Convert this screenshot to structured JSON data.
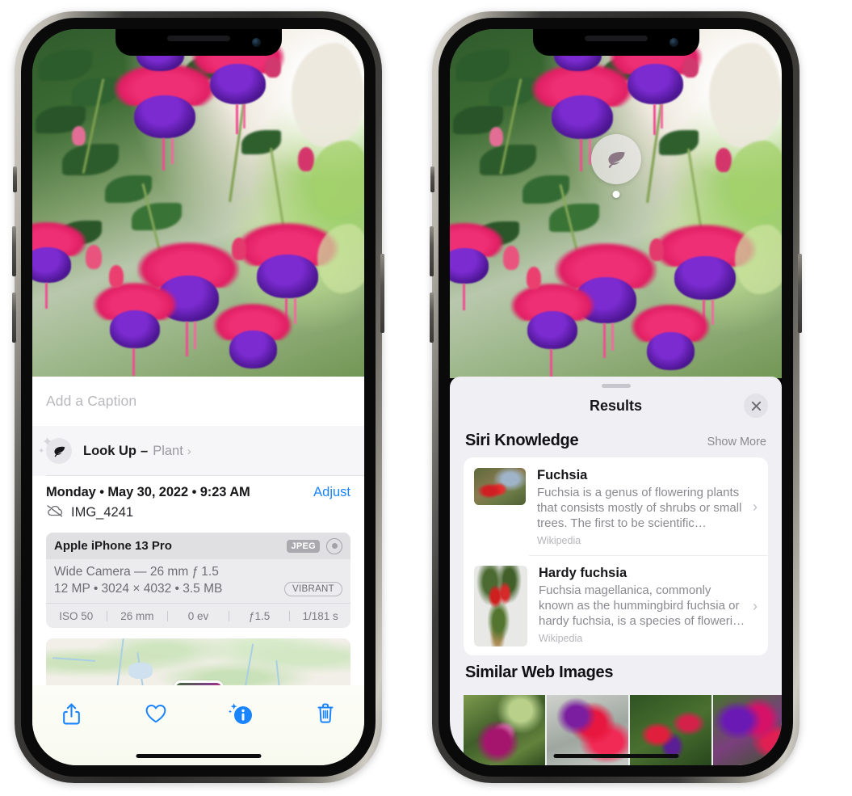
{
  "left_phone": {
    "name": "iphone-photos-info",
    "caption": {
      "placeholder": "Add a Caption",
      "value": ""
    },
    "look_up": {
      "icon": "leaf-icon",
      "title": "Look Up",
      "dash": "–",
      "subject": "Plant",
      "chevron": "›"
    },
    "metadata": {
      "date_line": "Monday • May 30, 2022 • 9:23 AM",
      "adjust_label": "Adjust",
      "cloud_icon": "icloud-slash-icon",
      "filename": "IMG_4241"
    },
    "camera_card": {
      "model": "Apple iPhone 13 Pro",
      "format_badge": "JPEG",
      "raw_icon": "raw-target-icon",
      "lens_line": "Wide Camera — 26 mm ƒ 1.5",
      "size_line": "12 MP • 3024 × 4032 • 3.5 MB",
      "profile_badge": "VIBRANT",
      "exif": [
        "ISO 50",
        "26 mm",
        "0 ev",
        "ƒ1.5",
        "1/181 s"
      ]
    },
    "map": {
      "pin": "photo-pin"
    },
    "toolbar": [
      {
        "name": "share-button",
        "icon": "share-icon"
      },
      {
        "name": "favorite-button",
        "icon": "heart-icon"
      },
      {
        "name": "info-button",
        "icon": "info-sparkle-icon"
      },
      {
        "name": "delete-button",
        "icon": "trash-icon"
      }
    ],
    "accent_color": "#1A84FF"
  },
  "right_phone": {
    "name": "iphone-visual-lookup-results",
    "visual_lookup_badge": {
      "icon": "leaf-icon"
    },
    "sheet": {
      "title": "Results",
      "close_icon": "close-icon",
      "sections": [
        {
          "title": "Siri Knowledge",
          "action": "Show More",
          "items": [
            {
              "title": "Fuchsia",
              "description": "Fuchsia is a genus of flowering plants that consists mostly of shrubs or small trees. The first to be scientific…",
              "source": "Wikipedia",
              "chevron": "›"
            },
            {
              "title": "Hardy fuchsia",
              "description": "Fuchsia magellanica, commonly known as the hummingbird fuchsia or hardy fuchsia, is a species of floweri…",
              "source": "Wikipedia",
              "chevron": "›"
            }
          ]
        },
        {
          "title": "Similar Web Images",
          "items": [
            {
              "alt": "fuchsia-web-image-1"
            },
            {
              "alt": "fuchsia-web-image-2"
            },
            {
              "alt": "fuchsia-web-image-3"
            },
            {
              "alt": "fuchsia-web-image-4"
            }
          ]
        }
      ]
    }
  }
}
